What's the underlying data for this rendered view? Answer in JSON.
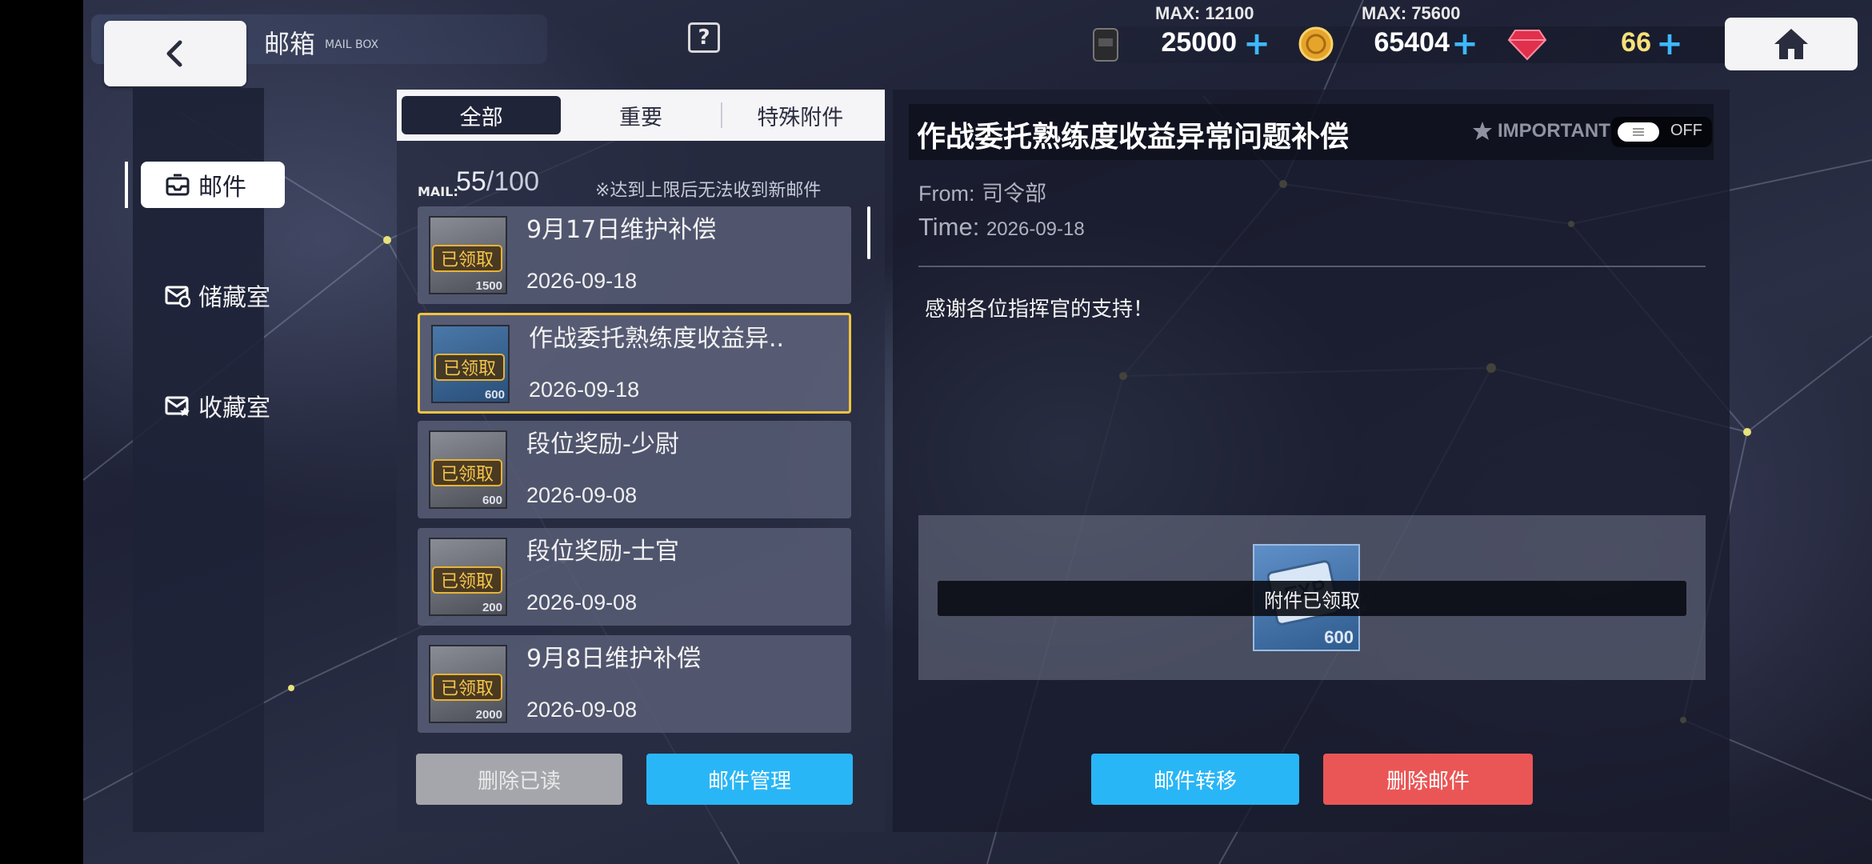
{
  "header": {
    "title": "邮箱",
    "subtitle": "MAIL BOX",
    "help_icon": "?"
  },
  "resources": [
    {
      "icon": "fuel-barrel-icon",
      "max": "MAX: 12100",
      "value": "25000"
    },
    {
      "icon": "gold-coin-icon",
      "max": "MAX: 75600",
      "value": "65404"
    },
    {
      "icon": "ruby-gem-icon",
      "max": "",
      "value": "66"
    }
  ],
  "nav": {
    "items": [
      {
        "label": "邮件",
        "icon": "inbox-icon",
        "active": true
      },
      {
        "label": "储藏室",
        "icon": "storage-mail-icon",
        "active": false
      },
      {
        "label": "收藏室",
        "icon": "favorite-mail-icon",
        "active": false
      }
    ]
  },
  "tabs": [
    {
      "label": "全部",
      "active": true
    },
    {
      "label": "重要",
      "active": false
    },
    {
      "label": "特殊附件",
      "active": false
    }
  ],
  "mail_box": {
    "count_label": "MAIL:",
    "count": "55",
    "limit": "/100",
    "hint": "※达到上限后无法收到新邮件"
  },
  "mails": [
    {
      "title": "9月17日维护补偿",
      "date": "2026-09-18",
      "badge": "已领取",
      "qty": "1500",
      "thumb": "fuel-pack-icon",
      "selected": false
    },
    {
      "title": "作战委托熟练度收益异..",
      "date": "2026-09-18",
      "badge": "已领取",
      "qty": "600",
      "thumb": "exp-card-icon",
      "selected": true
    },
    {
      "title": "段位奖励-少尉",
      "date": "2026-09-08",
      "badge": "已领取",
      "qty": "600",
      "thumb": "crossed-swords-icon",
      "selected": false
    },
    {
      "title": "段位奖励-士官",
      "date": "2026-09-08",
      "badge": "已领取",
      "qty": "200",
      "thumb": "crossed-swords-icon",
      "selected": false
    },
    {
      "title": "9月8日维护补偿",
      "date": "2026-09-08",
      "badge": "已领取",
      "qty": "2000",
      "thumb": "fuel-pack-icon",
      "selected": false
    }
  ],
  "list_buttons": {
    "delete_read": "删除已读",
    "manage": "邮件管理"
  },
  "detail": {
    "title": "作战委托熟练度收益异常问题补偿",
    "important_label": "IMPORTANT",
    "toggle_state": "OFF",
    "from_label": "From:",
    "from_value": "司令部",
    "time_label": "Time:",
    "time_value": "2026-09-18",
    "body": "感谢各位指挥官的支持！",
    "attachment_qty": "600",
    "attachment_status": "附件已领取",
    "transfer_button": "邮件转移",
    "delete_button": "删除邮件"
  }
}
